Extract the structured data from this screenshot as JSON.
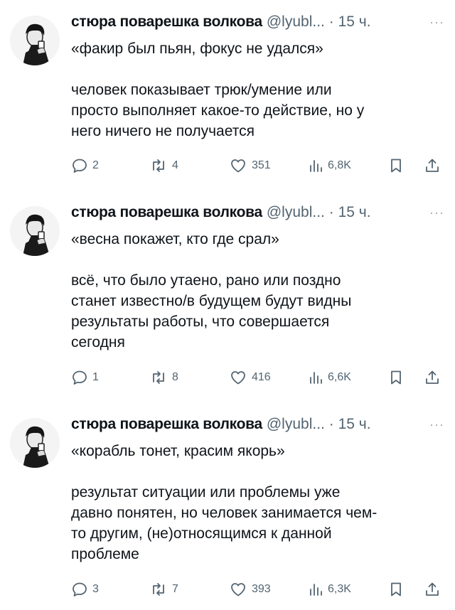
{
  "tweets": [
    {
      "author_name": "стюра поварешка волкова",
      "handle": "@lyubl...",
      "sep": "·",
      "time": "15 ч.",
      "more": "···",
      "quote": "«факир был пьян, фокус не удался»",
      "body": [
        "человек показывает трюк/умение или",
        "просто выполняет какое-то действие, но у",
        "него ничего не получается"
      ],
      "replies": "2",
      "reposts": "4",
      "likes": "351",
      "views": "6,8K"
    },
    {
      "author_name": "стюра поварешка волкова",
      "handle": "@lyubl...",
      "sep": "·",
      "time": "15 ч.",
      "more": "···",
      "quote": "«весна покажет, кто где срал»",
      "body": [
        "всё, что было утаено, рано или поздно",
        "станет известно/в будущем будут видны",
        "результаты работы, что совершается",
        "сегодня"
      ],
      "replies": "1",
      "reposts": "8",
      "likes": "416",
      "views": "6,6K"
    },
    {
      "author_name": "стюра поварешка волкова",
      "handle": "@lyubl...",
      "sep": "·",
      "time": "15 ч.",
      "more": "···",
      "quote": "«корабль тонет, красим якорь»",
      "body": [
        "результат ситуации или проблемы уже",
        "давно понятен, но человек занимается чем-",
        "то другим, (не)относящимся к данной",
        "проблеме"
      ],
      "replies": "3",
      "reposts": "7",
      "likes": "393",
      "views": "6,3K"
    }
  ],
  "icons": {
    "reply": "speech-bubble-icon",
    "repost": "repost-arrows-icon",
    "like": "heart-icon",
    "views": "bar-chart-icon",
    "bookmark": "bookmark-icon",
    "share": "share-upload-icon"
  }
}
